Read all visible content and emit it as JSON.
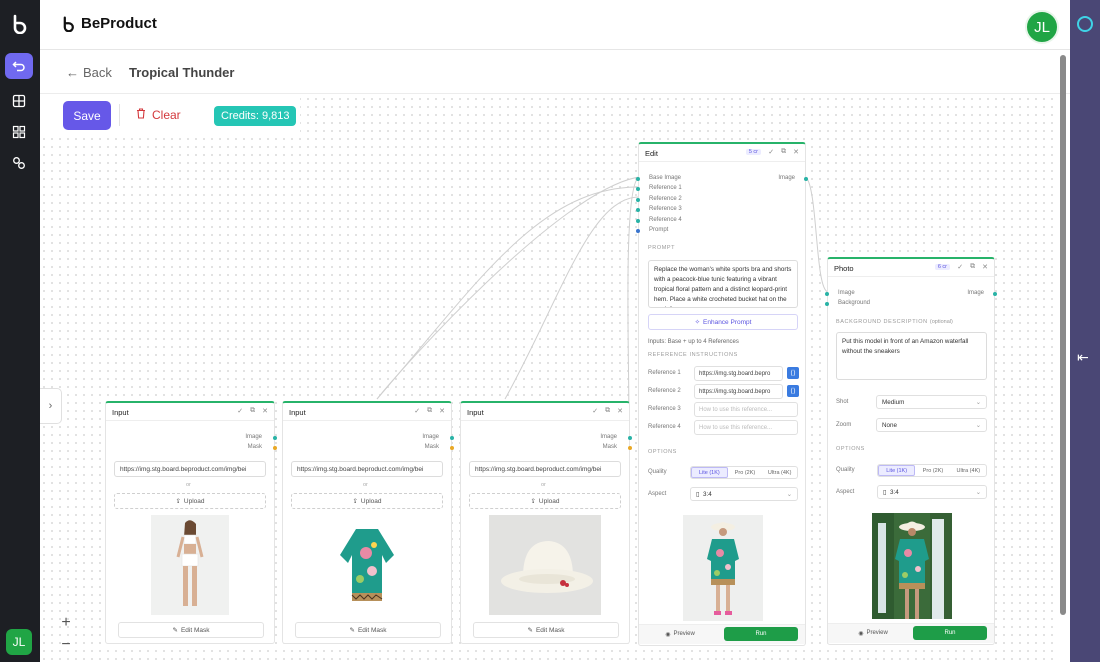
{
  "brand": {
    "name": "BeProduct"
  },
  "user": {
    "initials": "JL"
  },
  "nav": {
    "back_label": "Back",
    "page_title": "Tropical Thunder"
  },
  "toolbar": {
    "save_label": "Save",
    "clear_label": "Clear",
    "credits_label": "Credits: 9,813"
  },
  "rail": {
    "items": [
      "logo-icon",
      "undo-icon",
      "grid-icon",
      "apps-icon",
      "nodes-icon"
    ],
    "avatar_initials": "JL"
  },
  "zoom": {
    "in": "+",
    "out": "−"
  },
  "input_nodes": [
    {
      "title": "Input",
      "port_image": "Image",
      "port_mask": "Mask",
      "url": "https://img.stg.board.beproduct.com/img/bei",
      "or": "or",
      "upload": "Upload",
      "edit_mask": "Edit Mask"
    },
    {
      "title": "Input",
      "port_image": "Image",
      "port_mask": "Mask",
      "url": "https://img.stg.board.beproduct.com/img/bei",
      "or": "or",
      "upload": "Upload",
      "edit_mask": "Edit Mask"
    },
    {
      "title": "Input",
      "port_image": "Image",
      "port_mask": "Mask",
      "url": "https://img.stg.board.beproduct.com/img/bei",
      "or": "or",
      "upload": "Upload",
      "edit_mask": "Edit Mask"
    }
  ],
  "edit_node": {
    "title": "Edit",
    "credits": "5 cr",
    "inputs": [
      "Base Image",
      "Reference 1",
      "Reference 2",
      "Reference 3",
      "Reference 4",
      "Prompt"
    ],
    "output": "Image",
    "prompt_label": "PROMPT",
    "prompt_text": "Replace the woman's white sports bra and shorts with a peacock-blue tunic featuring a vibrant tropical floral pattern and a distinct leopard-print hem. Place a white crocheted bucket hat on the model's",
    "enhance_label": "Enhance Prompt",
    "inputs_note": "Inputs: Base + up to 4 References",
    "ref_instructions_label": "REFERENCE INSTRUCTIONS",
    "references": [
      {
        "label": "Reference 1",
        "value": "https://img.stg.board.bepro",
        "placeholder": ""
      },
      {
        "label": "Reference 2",
        "value": "https://img.stg.board.bepro",
        "placeholder": ""
      },
      {
        "label": "Reference 3",
        "value": "",
        "placeholder": "How to use this reference..."
      },
      {
        "label": "Reference 4",
        "value": "",
        "placeholder": "How to use this reference..."
      }
    ],
    "options_label": "OPTIONS",
    "quality_label": "Quality",
    "quality_options": [
      "Lite (1K)",
      "Pro (2K)",
      "Ultra (4K)"
    ],
    "quality_selected": "Lite (1K)",
    "aspect_label": "Aspect",
    "aspect_value": "3:4",
    "preview_label": "Preview",
    "run_label": "Run"
  },
  "photo_node": {
    "title": "Photo",
    "credits": "6 cr",
    "inputs": [
      "Image",
      "Background"
    ],
    "output": "Image",
    "bg_label": "BACKGROUND DESCRIPTION",
    "bg_optional": "(optional)",
    "bg_text": "Put this model in front of an Amazon waterfall without the sneakers",
    "shot_label": "Shot",
    "shot_value": "Medium",
    "zoom_label": "Zoom",
    "zoom_value": "None",
    "options_label": "OPTIONS",
    "quality_label": "Quality",
    "quality_options": [
      "Lite (1K)",
      "Pro (2K)",
      "Ultra (4K)"
    ],
    "quality_selected": "Lite (1K)",
    "aspect_label": "Aspect",
    "aspect_value": "3:4",
    "preview_label": "Preview",
    "run_label": "Run"
  }
}
